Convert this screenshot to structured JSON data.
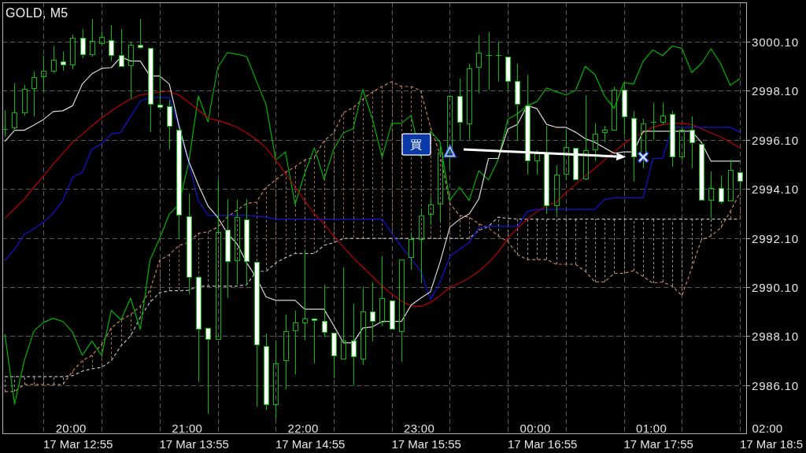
{
  "chart": {
    "chart_data": {
      "type": "candlestick",
      "title": "GOLD, M5",
      "grid": true,
      "xlim": [
        1163.7,
        1548.2
      ],
      "ylim": [
        2984.14,
        3001.7
      ],
      "yticks": [
        {
          "value": 3000.1,
          "label": "3000.10"
        },
        {
          "value": 2998.1,
          "label": "2998.10"
        },
        {
          "value": 2996.1,
          "label": "2996.10"
        },
        {
          "value": 2994.1,
          "label": "2994.10"
        },
        {
          "value": 2992.1,
          "label": "2992.10"
        },
        {
          "value": 2990.1,
          "label": "2990.10"
        },
        {
          "value": 2988.1,
          "label": "2988.10"
        },
        {
          "value": 2986.1,
          "label": "2986.10"
        }
      ],
      "xticks": [
        {
          "value": 1200,
          "label": "20:00"
        },
        {
          "value": 1260,
          "label": "21:00"
        },
        {
          "value": 1320,
          "label": "22:00"
        },
        {
          "value": 1380,
          "label": "23:00"
        }
      ],
      "x": [
        1165,
        1170,
        1175,
        1180,
        1185,
        1190,
        1195,
        1200,
        1205,
        1210,
        1215,
        1220,
        1225,
        1230,
        1235,
        1240,
        1245,
        1250,
        1255,
        1260,
        1265,
        1270,
        1275,
        1280,
        1285,
        1290,
        1295,
        1300,
        1305,
        1310,
        1315,
        1320,
        1325,
        1330,
        1335,
        1340,
        1345,
        1350,
        1355,
        1360,
        1365,
        1370,
        1375,
        1380,
        1385,
        1390,
        1395,
        1400,
        1405,
        1410,
        1415,
        1420,
        1425,
        1430,
        1435,
        1440,
        1445,
        1450,
        1455,
        1460,
        1465,
        1470,
        1475,
        1480,
        1485,
        1490,
        1495,
        1500,
        1505,
        1510,
        1515,
        1520,
        1525,
        1530,
        1535,
        1540,
        1545
      ],
      "ohlc": [
        [
          2996.54,
          2997.31,
          2996.22,
          2996.54
        ],
        [
          2996.61,
          2998.4,
          2996.48,
          2997.21
        ],
        [
          2997.21,
          2998.33,
          2997.08,
          2998.17
        ],
        [
          2998.21,
          2998.89,
          2997.05,
          2998.67
        ],
        [
          2998.69,
          2999.53,
          2998.05,
          2998.9
        ],
        [
          2998.92,
          2999.92,
          2998.82,
          2999.35
        ],
        [
          2999.31,
          2999.7,
          2998.92,
          2999.17
        ],
        [
          2999.17,
          3000.39,
          2998.98,
          3000.26
        ],
        [
          3000.26,
          3000.61,
          2999.43,
          2999.59
        ],
        [
          2999.59,
          3001.03,
          2999.49,
          3000.13
        ],
        [
          3000.04,
          3000.52,
          2999.97,
          3000.29
        ],
        [
          3000.17,
          3000.77,
          2999.31,
          2999.56
        ],
        [
          2999.54,
          3000.61,
          2999.09,
          2999.12
        ],
        [
          2999.14,
          3000.1,
          2997.76,
          2999.97
        ],
        [
          2999.97,
          3001.03,
          2999.81,
          2999.88
        ],
        [
          2999.85,
          2999.85,
          2996.41,
          2997.56
        ],
        [
          2997.53,
          2998.98,
          2997.37,
          2997.45
        ],
        [
          2997.47,
          2997.71,
          2995.71,
          2996.67
        ],
        [
          2996.51,
          2996.51,
          2992.08,
          2993.05
        ],
        [
          2992.99,
          2993.9,
          2989.81,
          2990.52
        ],
        [
          2990.52,
          2990.52,
          2986.23,
          2988.4
        ],
        [
          2988.43,
          2988.43,
          2984.94,
          2987.99
        ],
        [
          2987.99,
          2994.46,
          2987.99,
          2992.34
        ],
        [
          2992.44,
          2993.69,
          2989.65,
          2991.16
        ],
        [
          2991.19,
          2993.66,
          2990.2,
          2992.94
        ],
        [
          2992.86,
          2993.69,
          2990.2,
          2991.16
        ],
        [
          2991.13,
          2991.13,
          2985.23,
          2987.76
        ],
        [
          2987.7,
          2988.21,
          2985.1,
          2985.33
        ],
        [
          2985.33,
          2987.92,
          2984.72,
          2986.99
        ],
        [
          2987.12,
          2988.98,
          2985.94,
          2988.31
        ],
        [
          2988.34,
          2989.14,
          2986.54,
          2988.66
        ],
        [
          2988.66,
          2991.64,
          2987.92,
          2988.82
        ],
        [
          2988.82,
          2988.82,
          2986.99,
          2988.74
        ],
        [
          2988.72,
          2990.2,
          2988.05,
          2988.27
        ],
        [
          2988.24,
          2988.24,
          2986.38,
          2987.31
        ],
        [
          2987.18,
          2990.9,
          2987.18,
          2987.92
        ],
        [
          2987.92,
          2989.43,
          2986.1,
          2987.28
        ],
        [
          2987.18,
          2990.13,
          2986.93,
          2989.11
        ],
        [
          2989.11,
          2990.29,
          2987.89,
          2988.72
        ],
        [
          2988.69,
          2991.35,
          2988.53,
          2989.65
        ],
        [
          2989.56,
          2989.56,
          2988.4,
          2988.4
        ],
        [
          2988.31,
          2991.22,
          2987.06,
          2991.22
        ],
        [
          2991.32,
          2992.34,
          2990.8,
          2992.05
        ],
        [
          2992.05,
          2993.29,
          2990.26,
          2993.02
        ],
        [
          2993.08,
          2993.79,
          2992.63,
          2993.47
        ],
        [
          2993.5,
          2995.84,
          2992.79,
          2995.58
        ],
        [
          2995.61,
          2997.92,
          2994.89,
          2997.89
        ],
        [
          2997.89,
          2998.59,
          2996.1,
          2996.83
        ],
        [
          2996.77,
          2999.2,
          2996.1,
          2999.01
        ],
        [
          2999.06,
          3000.36,
          2997.98,
          2999.65
        ],
        [
          2999.56,
          3000.49,
          2998.14,
          2999.56
        ],
        [
          2999.56,
          3000.1,
          2998.48,
          2999.56
        ],
        [
          2999.49,
          2999.49,
          2998.14,
          2998.5
        ],
        [
          2998.48,
          2999.2,
          2996.06,
          2997.56
        ],
        [
          2997.5,
          2998.75,
          2994.68,
          2995.26
        ],
        [
          2995.26,
          2995.68,
          2994.68,
          2995.55
        ],
        [
          2995.58,
          2996.67,
          2993.08,
          2993.43
        ],
        [
          2993.43,
          2995.07,
          2992.95,
          2994.68
        ],
        [
          2994.72,
          2996.51,
          2994.46,
          2995.81
        ],
        [
          2995.77,
          2995.77,
          2994.5,
          2994.5
        ],
        [
          2994.52,
          2997.92,
          2994.46,
          2995.68
        ],
        [
          2995.71,
          2996.77,
          2995.23,
          2996.35
        ],
        [
          2996.41,
          2996.67,
          2996.0,
          2996.51
        ],
        [
          2996.51,
          2998.27,
          2996.51,
          2998.14
        ],
        [
          2998.14,
          2998.37,
          2996.29,
          2997.05
        ],
        [
          2996.99,
          2997.28,
          2994.4,
          2995.42
        ],
        [
          2995.5,
          2996.96,
          2994.94,
          2996.77
        ],
        [
          2996.83,
          2997.6,
          2996.1,
          2996.83
        ],
        [
          2996.83,
          2997.6,
          2996.72,
          2997.1
        ],
        [
          2997.15,
          2997.29,
          2995.0,
          2995.42
        ],
        [
          2995.42,
          2996.61,
          2995.29,
          2996.5
        ],
        [
          2996.5,
          2997.05,
          2994.94,
          2996.0
        ],
        [
          2995.93,
          2995.93,
          2993.65,
          2993.65
        ],
        [
          2993.65,
          2994.81,
          2992.9,
          2994.15
        ],
        [
          2994.15,
          2994.64,
          2993.5,
          2993.6
        ],
        [
          2993.63,
          2995.29,
          2993.63,
          2994.86
        ],
        [
          2994.78,
          2994.78,
          2994.01,
          2994.43
        ]
      ],
      "series": [
        {
          "type": "line",
          "line_style": "dashed",
          "color": "#c8855a",
          "values": [
            2985.84,
            2985.84,
            2986.13,
            2986.13,
            2986.13,
            2986.13,
            2986.13,
            2986.67,
            2987.1,
            2987.32,
            2987.76,
            2988.43,
            2988.76,
            2988.98,
            2989.31,
            2989.97,
            2991.19,
            2991.42,
            2991.8,
            2991.91,
            2992.29,
            2992.35,
            2992.54,
            2992.95,
            2993.24,
            2993.51,
            2993.56,
            2994.17,
            2994.46,
            2994.78,
            2995.0,
            2995.28,
            2995.39,
            2996.06,
            2996.38,
            2997.21,
            2997.41,
            2997.76,
            2998.05,
            2998.27,
            2998.47,
            2998.27,
            2998.27,
            2998.1,
            2996.61,
            2995.5,
            2993.51,
            2993.02,
            2992.95,
            2992.68,
            2992.51,
            2992.18,
            2991.96,
            2991.42,
            2991.22,
            2991.22,
            2991.22,
            2991.03,
            2991.03,
            2991.03,
            2990.74,
            2990.31,
            2990.31,
            2990.66,
            2990.66,
            2990.77,
            2990.53,
            2990.26,
            2990.31,
            2990.14,
            2989.75,
            2990.86,
            2992.02,
            2992.18,
            2992.51,
            2993.18,
            2993.95
          ]
        },
        {
          "type": "line",
          "line_style": "dashed",
          "color": "#bcbcbc",
          "values": [
            2986.45,
            2986.45,
            2986.45,
            2986.45,
            2986.45,
            2986.45,
            2986.45,
            2986.49,
            2986.67,
            2986.77,
            2986.83,
            2987.1,
            2987.71,
            2988.1,
            2988.87,
            2989.48,
            2989.87,
            2989.95,
            2989.95,
            2989.97,
            2990.14,
            2990.14,
            2990.14,
            2990.14,
            2990.14,
            2990.2,
            2990.74,
            2990.74,
            2991.08,
            2991.3,
            2991.47,
            2991.47,
            2991.47,
            2991.8,
            2991.91,
            2992.08,
            2992.08,
            2992.08,
            2992.08,
            2992.08,
            2992.08,
            2992.08,
            2992.08,
            2992.08,
            2992.08,
            2992.08,
            2992.08,
            2992.08,
            2992.08,
            2992.41,
            2992.57,
            2992.95,
            2992.9,
            2992.87,
            2992.87,
            2992.87,
            2992.87,
            2992.87,
            2992.87,
            2992.87,
            2992.87,
            2992.87,
            2992.87,
            2992.87,
            2992.87,
            2992.87,
            2992.87,
            2992.87,
            2992.87,
            2992.87,
            2992.87,
            2992.87,
            2992.87,
            2992.87,
            2992.87,
            2992.87,
            2992.87
          ]
        },
        {
          "type": "line",
          "line_style": "solid",
          "color": "#00b400",
          "values": [
            2988.18,
            2985.33,
            2987.1,
            2988.31,
            2988.66,
            2988.82,
            2988.7,
            2988.26,
            2987.32,
            2987.9,
            2987.32,
            2989.15,
            2988.76,
            2989.65,
            2988.37,
            2991.19,
            2992.08,
            2993.07,
            2993.47,
            2995.16,
            2997.88,
            2996.83,
            2999.04,
            2999.65,
            2999.59,
            2999.49,
            2998.5,
            2997.54,
            2995.28,
            2995.61,
            2993.47,
            2994.73,
            2995.77,
            2994.5,
            2995.72,
            2996.38,
            2996.55,
            2998.15,
            2996.94,
            2995.39,
            2996.77,
            2996.77,
            2997.1,
            2995.39,
            2996.45,
            2996.0,
            2993.63,
            2994.17,
            2993.63,
            2994.84,
            2994.46,
            2995.29,
            2996.94,
            2997.16,
            2997.49,
            2997.66,
            2998.21,
            2998.06,
            2997.93,
            2998.1,
            2999.09,
            2998.76,
            2997.88,
            2997.38,
            2998.43,
            2998.37,
            2999.31,
            2999.76,
            2999.53,
            2999.92,
            2999.83,
            2998.84,
            2999.2,
            2999.81,
            2999.2,
            2998.32,
            2998.59
          ]
        },
        {
          "type": "line",
          "line_style": "solid",
          "color": "#c00000",
          "values": [
            2992.9,
            2993.29,
            2993.68,
            2994.17,
            2994.62,
            2995.11,
            2995.55,
            2996.0,
            2996.33,
            2996.67,
            2996.99,
            2997.28,
            2997.53,
            2997.76,
            2997.93,
            2997.98,
            2998.05,
            2998.08,
            2997.93,
            2997.63,
            2997.32,
            2996.99,
            2996.89,
            2996.77,
            2996.61,
            2996.38,
            2996.11,
            2995.77,
            2995.28,
            2994.73,
            2994.17,
            2993.62,
            2993.08,
            2992.68,
            2992.18,
            2991.73,
            2991.3,
            2990.91,
            2990.53,
            2990.14,
            2989.81,
            2989.53,
            2989.33,
            2989.31,
            2989.48,
            2989.75,
            2990.09,
            2990.26,
            2990.47,
            2990.75,
            2991.09,
            2991.52,
            2992.08,
            2992.51,
            2992.86,
            2993.18,
            2993.4,
            2993.56,
            2993.95,
            2994.28,
            2994.62,
            2994.94,
            2995.28,
            2995.61,
            2995.94,
            2996.22,
            2996.38,
            2996.61,
            2996.72,
            2996.77,
            2996.77,
            2996.72,
            2996.55,
            2996.38,
            2996.22,
            2996.0,
            2995.77
          ]
        },
        {
          "type": "line",
          "line_style": "solid",
          "color": "#1414d2",
          "values": [
            2991.19,
            2991.64,
            2992.25,
            2992.47,
            2992.74,
            2993.12,
            2993.63,
            2994.56,
            2994.78,
            2995.72,
            2995.94,
            2996.33,
            2996.41,
            2997.05,
            2997.67,
            2997.83,
            2997.83,
            2997.83,
            2996.61,
            2995.16,
            2993.63,
            2993.02,
            2993.02,
            2993.02,
            2993.02,
            2993.02,
            2992.99,
            2992.95,
            2992.87,
            2992.87,
            2992.87,
            2992.87,
            2992.87,
            2992.87,
            2992.87,
            2992.87,
            2992.87,
            2992.87,
            2992.87,
            2992.87,
            2992.29,
            2991.74,
            2991.25,
            2990.75,
            2989.59,
            2990.31,
            2991.35,
            2991.64,
            2991.91,
            2992.51,
            2992.57,
            2992.57,
            2992.57,
            2992.57,
            2993.18,
            2993.27,
            2993.27,
            2993.27,
            2993.27,
            2993.27,
            2993.27,
            2993.27,
            2993.68,
            2993.73,
            2993.73,
            2993.73,
            2993.73,
            2995.34,
            2995.34,
            2996.61,
            2996.61,
            2996.61,
            2996.61,
            2996.61,
            2996.61,
            2996.61,
            2996.41
          ]
        },
        {
          "type": "line",
          "line_style": "solid",
          "color": "#d8d8d8",
          "values": [
            2996.03,
            2996.49,
            2996.49,
            2996.7,
            2996.93,
            2997.25,
            2997.28,
            2997.49,
            2998.37,
            2998.79,
            2999.01,
            2999.04,
            2999.48,
            2999.31,
            2999.31,
            2998.7,
            2998.7,
            2998.37,
            2996.67,
            2995.23,
            2994.27,
            2993.4,
            2992.95,
            2992.29,
            2991.86,
            2991.09,
            2990.49,
            2989.7,
            2989.56,
            2989.56,
            2989.56,
            2989.2,
            2989.2,
            2989.2,
            2988.53,
            2987.83,
            2987.83,
            2988.43,
            2988.48,
            2988.7,
            2988.7,
            2988.7,
            2989.36,
            2989.65,
            2989.91,
            2991.13,
            2992.54,
            2992.86,
            2993.08,
            2993.69,
            2995.34,
            2995.34,
            2996.54,
            2996.73,
            2997.5,
            2997.37,
            2996.73,
            2996.61,
            2996.61,
            2996.41,
            2996.15,
            2996.0,
            2995.77,
            2995.55,
            2995.61,
            2995.61,
            2996.45,
            2996.45,
            2996.45,
            2996.45,
            2996.45,
            2996.45,
            2996.0,
            2995.23,
            2995.23,
            2995.23,
            2995.23
          ]
        }
      ],
      "annotations": [
        "買",
        {
          "text": "△",
          "x": 1395,
          "y": 2995.61
        },
        {
          "text": "×",
          "x": 1495,
          "y": 2995.5
        }
      ]
    },
    "next_day_time_labels": [
      "00:00",
      "01:00",
      "02:00"
    ]
  },
  "lower_time_labels": [
    "17 Mar 12:55",
    "17 Mar 13:55",
    "17 Mar 14:55",
    "17 Mar 15:55",
    "17 Mar 16:55",
    "17 Mar 17:55",
    "17 Mar 18:5"
  ]
}
